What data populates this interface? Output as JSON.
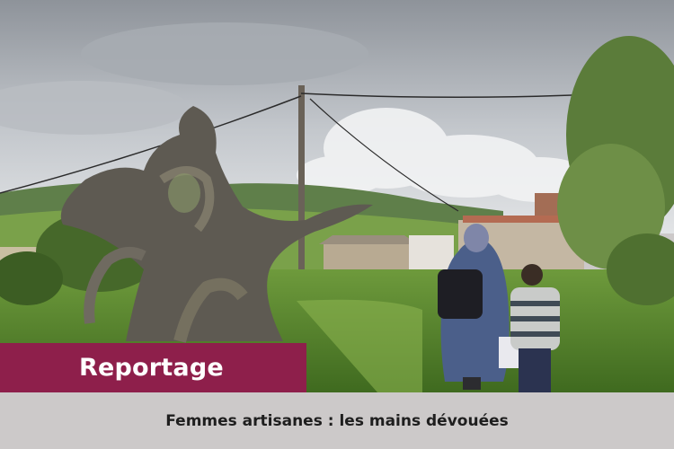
{
  "photo": {
    "icon": "rural-village-photo"
  },
  "badge": {
    "label": "Reportage",
    "color": "#8e1f4b"
  },
  "caption": {
    "text": "Femmes artisanes : les mains dévouées",
    "background": "#ccc9c9"
  }
}
